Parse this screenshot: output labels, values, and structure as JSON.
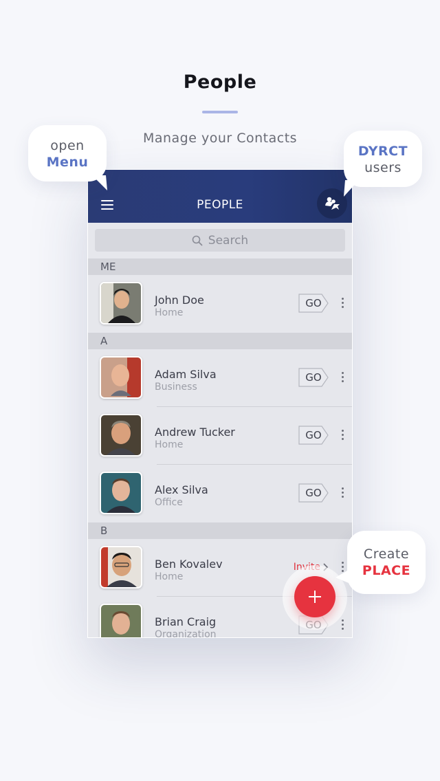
{
  "page": {
    "title": "People",
    "subtitle": "Manage your Contacts"
  },
  "callouts": {
    "menu": {
      "line1": "open",
      "line2": "Menu"
    },
    "dyrct": {
      "line1": "DYRCT",
      "line2": "users"
    },
    "create": {
      "line1": "Create",
      "line2": "PLACE"
    }
  },
  "app": {
    "header_title": "PEOPLE",
    "search_placeholder": "Search",
    "go_label": "GO",
    "invite_label": "Invite",
    "sections": [
      {
        "label": "ME"
      },
      {
        "label": "A"
      },
      {
        "label": "B"
      }
    ],
    "contacts": [
      {
        "name": "John Doe",
        "sub": "Home"
      },
      {
        "name": "Adam Silva",
        "sub": "Business"
      },
      {
        "name": "Andrew Tucker",
        "sub": "Home"
      },
      {
        "name": "Alex Silva",
        "sub": "Office"
      },
      {
        "name": "Ben Kovalev",
        "sub": "Home"
      },
      {
        "name": "Brian Craig",
        "sub": "Organization"
      }
    ]
  },
  "colors": {
    "accent_blue": "#5a74c4",
    "accent_red": "#e6333f",
    "header_navy": "#293c7c"
  },
  "icons": {
    "menu": "hamburger-icon",
    "dyrct": "users-send-icon",
    "search": "search-icon",
    "fab": "plus-icon",
    "more": "kebab-icon"
  }
}
